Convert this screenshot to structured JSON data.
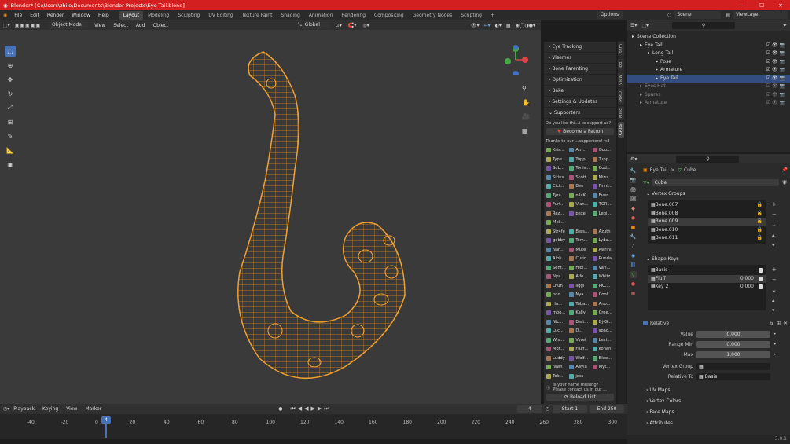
{
  "window": {
    "title": "Blender* [C:\\Users\\zhile\\Documents\\Blender Projects\\Eye Tail.blend]",
    "minimize": "—",
    "maximize": "☐",
    "close": "✕"
  },
  "menu": {
    "items": [
      "File",
      "Edit",
      "Render",
      "Window",
      "Help"
    ]
  },
  "workspaces": [
    "Layout",
    "Modeling",
    "Sculpting",
    "UV Editing",
    "Texture Paint",
    "Shading",
    "Animation",
    "Rendering",
    "Compositing",
    "Geometry Nodes",
    "Scripting"
  ],
  "workspace_add": "+",
  "scene": {
    "label": "Scene",
    "view_layer": "ViewLayer"
  },
  "viewport": {
    "mode": "Object Mode",
    "view": "View",
    "select": "Select",
    "add": "Add",
    "object": "Object",
    "transform": "Global",
    "options": "Options"
  },
  "npanel": {
    "sections": [
      "Eye Tracking",
      "Visemes",
      "Bone Parenting",
      "Optimization",
      "Bake",
      "Settings & Updates",
      "Supporters"
    ],
    "support_q": "Do you like thi...t to support us?",
    "patron": "Become a Patron",
    "thanks": "Thanks to our ...supporters! <3",
    "supporters": [
      "Kris...",
      "Atri...",
      "Goo...",
      "Type",
      "Tupp...",
      "Tupp...",
      "Sub...",
      "Tonis...",
      "Cod...",
      "Sirius",
      "Scott...",
      "Mizu...",
      "Cici...",
      "Bee",
      "Finni...",
      "Tyra...",
      "n1cK",
      "Even...",
      "Furt...",
      "Vian...",
      "TORI...",
      "Rez...",
      "pexe",
      "Legi...",
      "Meli...",
      "",
      "",
      "Str4fe",
      "Bers...",
      "Azuth",
      "gobby",
      "Tom...",
      "Lyda...",
      "Nar...",
      "Mute",
      "Awrini",
      "Alph...",
      "Curio",
      "Runda",
      "Sent...",
      "Hidi...",
      "Vari...",
      "Nya...",
      "Alfo...",
      "Whitz",
      "Lhun",
      "liggi",
      "PKC...",
      "hon...",
      "Nya...",
      "Cool...",
      "Ha...",
      "Taba...",
      "Ano...",
      "moo...",
      "Kally",
      "Cree...",
      "Nic...",
      "Bert...",
      "Dj-G...",
      "Luci...",
      "D...",
      "spac...",
      "Wis...",
      "Vyrei",
      "Lexi...",
      "Mor...",
      "Fluff...",
      "konan",
      "Luddy",
      "Wolf...",
      "Blue...",
      "fawn",
      "Aayla",
      "Myt...",
      "Tok...",
      "jess",
      ""
    ],
    "name_missing": "Is your name missing?",
    "contact": "Please contact us in our ...",
    "reload": "Reload List"
  },
  "vtabs": [
    "Item",
    "Tool",
    "View",
    "MMD",
    "Misc",
    "CATS"
  ],
  "outliner": {
    "items": [
      {
        "label": "Scene Collection",
        "indent": 0
      },
      {
        "label": "Eye Tail",
        "indent": 1
      },
      {
        "label": "Long Tail",
        "indent": 2
      },
      {
        "label": "Pose",
        "indent": 3
      },
      {
        "label": "Armature",
        "indent": 3
      },
      {
        "label": "Eye Tail",
        "indent": 3,
        "selected": true
      },
      {
        "label": "Eyes Hat",
        "indent": 1,
        "dim": true
      },
      {
        "label": "Spares",
        "indent": 1,
        "dim": true
      },
      {
        "label": "Armature",
        "indent": 1,
        "dim": true
      }
    ]
  },
  "props": {
    "breadcrumb_obj": "Eye Tail",
    "breadcrumb_sep": ">",
    "breadcrumb_mesh": "Cube",
    "mesh_name": "Cube",
    "vertex_groups_title": "Vertex Groups",
    "vertex_groups": [
      "Bone.007",
      "Bone.008",
      "Bone.009",
      "Bone.010",
      "Bone.011"
    ],
    "shape_keys_title": "Shape Keys",
    "shape_keys": [
      {
        "name": "Basis",
        "value": ""
      },
      {
        "name": "Fluff",
        "value": "0.000"
      },
      {
        "name": "Key 2",
        "value": "0.000"
      }
    ],
    "relative": "Relative",
    "value_label": "Value",
    "value": "0.000",
    "range_min_label": "Range Min",
    "range_min": "0.000",
    "max_label": "Max",
    "max": "1.000",
    "vertex_group_label": "Vertex Group",
    "relative_to_label": "Relative To",
    "relative_to": "Basis",
    "collapsed": [
      "UV Maps",
      "Vertex Colors",
      "Face Maps",
      "Attributes"
    ]
  },
  "timeline": {
    "playback": "Playback",
    "keying": "Keying",
    "view": "View",
    "marker": "Marker",
    "frame": "4",
    "start_label": "Start",
    "start": "1",
    "end_label": "End",
    "end": "250",
    "ticks": [
      "-40",
      "-20",
      "0",
      "20",
      "40",
      "60",
      "80",
      "100",
      "120",
      "140",
      "160",
      "180",
      "200",
      "220",
      "240",
      "260",
      "280",
      "300"
    ],
    "current": "4"
  },
  "status": {
    "version": "3.0.1"
  }
}
